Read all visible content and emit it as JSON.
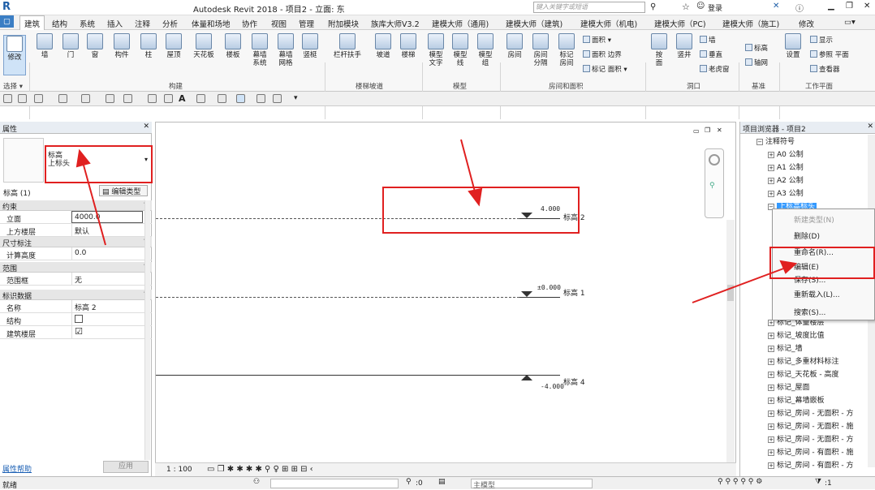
{
  "app": {
    "title": "Autodesk Revit 2018 -   项目2 - 立面: 东",
    "search_placeholder": "键入关键字或短语",
    "login": "登录"
  },
  "tabs": [
    "建筑",
    "结构",
    "系统",
    "插入",
    "注释",
    "分析",
    "体量和场地",
    "协作",
    "视图",
    "管理",
    "附加模块",
    "族库大师V3.2",
    "建模大师（通用)",
    "建模大师（建筑)",
    "建模大师（机电)",
    "建模大师（PC)",
    "建模大师（施工)",
    "修改"
  ],
  "ribbon": {
    "modify": "修改",
    "select": "选择 ▾",
    "build_buttons": [
      "墙",
      "门",
      "窗",
      "构件",
      "柱",
      "屋顶",
      "天花板",
      "楼板",
      "幕墙\n系统",
      "幕墙\n网格",
      "竖梃"
    ],
    "group_build": "构建",
    "stair_buttons": [
      "栏杆扶手",
      "坡道",
      "楼梯"
    ],
    "group_stair": "楼梯坡道",
    "model_buttons": [
      "模型\n文字",
      "模型\n线",
      "模型\n组"
    ],
    "group_model": "模型",
    "room_buttons": [
      "房间",
      "房间\n分隔",
      "标记\n房间"
    ],
    "room_small": [
      "面积 ▾",
      "面积 边界",
      "标记 面积 ▾"
    ],
    "group_room": "房间和面积",
    "opening_buttons": [
      "按\n面",
      "竖井"
    ],
    "opening_small": [
      "墙",
      "垂直",
      "老虎窗"
    ],
    "group_opening": "洞口",
    "datum_small": [
      "标高",
      "轴网"
    ],
    "group_datum": "基准",
    "wp_buttons": [
      "设置"
    ],
    "wp_small": [
      "显示",
      "参照 平面",
      "查看器"
    ],
    "group_wp": "工作平面"
  },
  "properties": {
    "title": "属性",
    "type_line1": "标高",
    "type_line2": "上标头",
    "count": "标高 (1)",
    "edit_type": "编辑类型",
    "sections": {
      "constraints": "约束",
      "dimensions": "尺寸标注",
      "extents": "范围",
      "identity": "标识数据"
    },
    "rows": {
      "elevation_k": "立面",
      "elevation_v": "4000.0",
      "above_k": "上方楼层",
      "above_v": "默认",
      "calc_k": "计算高度",
      "calc_v": "0.0",
      "scopebox_k": "范围框",
      "scopebox_v": "无",
      "name_k": "名称",
      "name_v": "标高 2",
      "struct_k": "结构",
      "bldg_k": "建筑楼层",
      "bldg_v": "☑"
    },
    "help": "属性帮助",
    "apply": "应用"
  },
  "canvas": {
    "levels": [
      {
        "value": "4.000",
        "name": "标高 2"
      },
      {
        "value": "±0.000",
        "name": "标高 1"
      },
      {
        "value": "-4.000",
        "name": "标高 4"
      }
    ],
    "scale": "1 : 100"
  },
  "browser": {
    "title": "项目浏览器 - 项目2",
    "items": [
      "注释符号",
      "A0 公制",
      "A1 公制",
      "A2 公制",
      "A3 公制",
      "上标高标头"
    ],
    "lower_items": [
      "标记_体量楼层",
      "标记_坡度比值",
      "标记_墙",
      "标记_多重材料标注",
      "标记_天花板 - 高度",
      "标记_屋面",
      "标记_幕墙嵌板",
      "标记_房间 - 无面积 - 方",
      "标记_房间 - 无面积 - 施",
      "标记_房间 - 无面积 - 方",
      "标记_房间 - 有面积 - 施",
      "标记_房间 - 有面积 - 方"
    ]
  },
  "context_menu": {
    "items": [
      "新建类型(N)",
      "删除(D)",
      "重命名(R)...",
      "编辑(E)",
      "保存(S)...",
      "重新载入(L)...",
      "搜索(S)..."
    ]
  },
  "status": {
    "ready": "就绪",
    "coord": ":0",
    "model": "主模型",
    "filter": ":1"
  },
  "colors": {
    "highlight": "#e02020",
    "selected_row": "#3399ff",
    "accent": "#3b7ec4"
  }
}
